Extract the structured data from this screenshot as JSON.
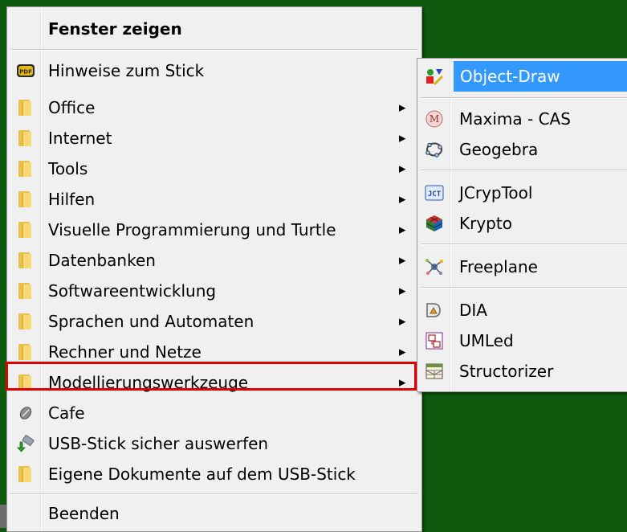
{
  "main_menu": {
    "header": "Fenster zeigen",
    "items": [
      {
        "label": "Hinweise zum Stick",
        "icon": "pdf-icon",
        "submenu": false
      },
      {
        "label": "Office",
        "icon": "folder-icon",
        "submenu": true
      },
      {
        "label": "Internet",
        "icon": "folder-icon",
        "submenu": true
      },
      {
        "label": "Tools",
        "icon": "folder-icon",
        "submenu": true
      },
      {
        "label": "Hilfen",
        "icon": "folder-icon",
        "submenu": true
      },
      {
        "label": "Visuelle Programmierung und Turtle",
        "icon": "folder-icon",
        "submenu": true
      },
      {
        "label": "Datenbanken",
        "icon": "folder-icon",
        "submenu": true
      },
      {
        "label": "Softwareentwicklung",
        "icon": "folder-icon",
        "submenu": true
      },
      {
        "label": "Sprachen und Automaten",
        "icon": "folder-icon",
        "submenu": true
      },
      {
        "label": "Rechner und Netze",
        "icon": "folder-icon",
        "submenu": true
      },
      {
        "label": "Modellierungswerkzeuge",
        "icon": "folder-icon",
        "submenu": true
      },
      {
        "label": "Cafe",
        "icon": "coffee-bean-icon",
        "submenu": false
      },
      {
        "label": "USB-Stick sicher auswerfen",
        "icon": "usb-eject-icon",
        "submenu": false
      },
      {
        "label": "Eigene Dokumente auf dem USB-Stick",
        "icon": "folder-icon",
        "submenu": false
      }
    ],
    "footer": "Beenden"
  },
  "sub_menu": {
    "items": [
      {
        "label": "Object-Draw",
        "icon": "object-draw-icon"
      },
      {
        "label": "Maxima - CAS",
        "icon": "maxima-icon"
      },
      {
        "label": "Geogebra",
        "icon": "geogebra-icon"
      },
      {
        "label": "JCrypTool",
        "icon": "jcryptool-icon"
      },
      {
        "label": "Krypto",
        "icon": "krypto-cube-icon"
      },
      {
        "label": "Freeplane",
        "icon": "freeplane-icon"
      },
      {
        "label": "DIA",
        "icon": "dia-icon"
      },
      {
        "label": "UMLed",
        "icon": "umled-icon"
      },
      {
        "label": "Structorizer",
        "icon": "structorizer-icon"
      }
    ]
  },
  "colors": {
    "desktop_background": "#0e5a0e",
    "menu_background": "#f0f0f0",
    "selection": "#3399ff",
    "highlight_box": "#e00000",
    "folder": "#f7d873"
  }
}
